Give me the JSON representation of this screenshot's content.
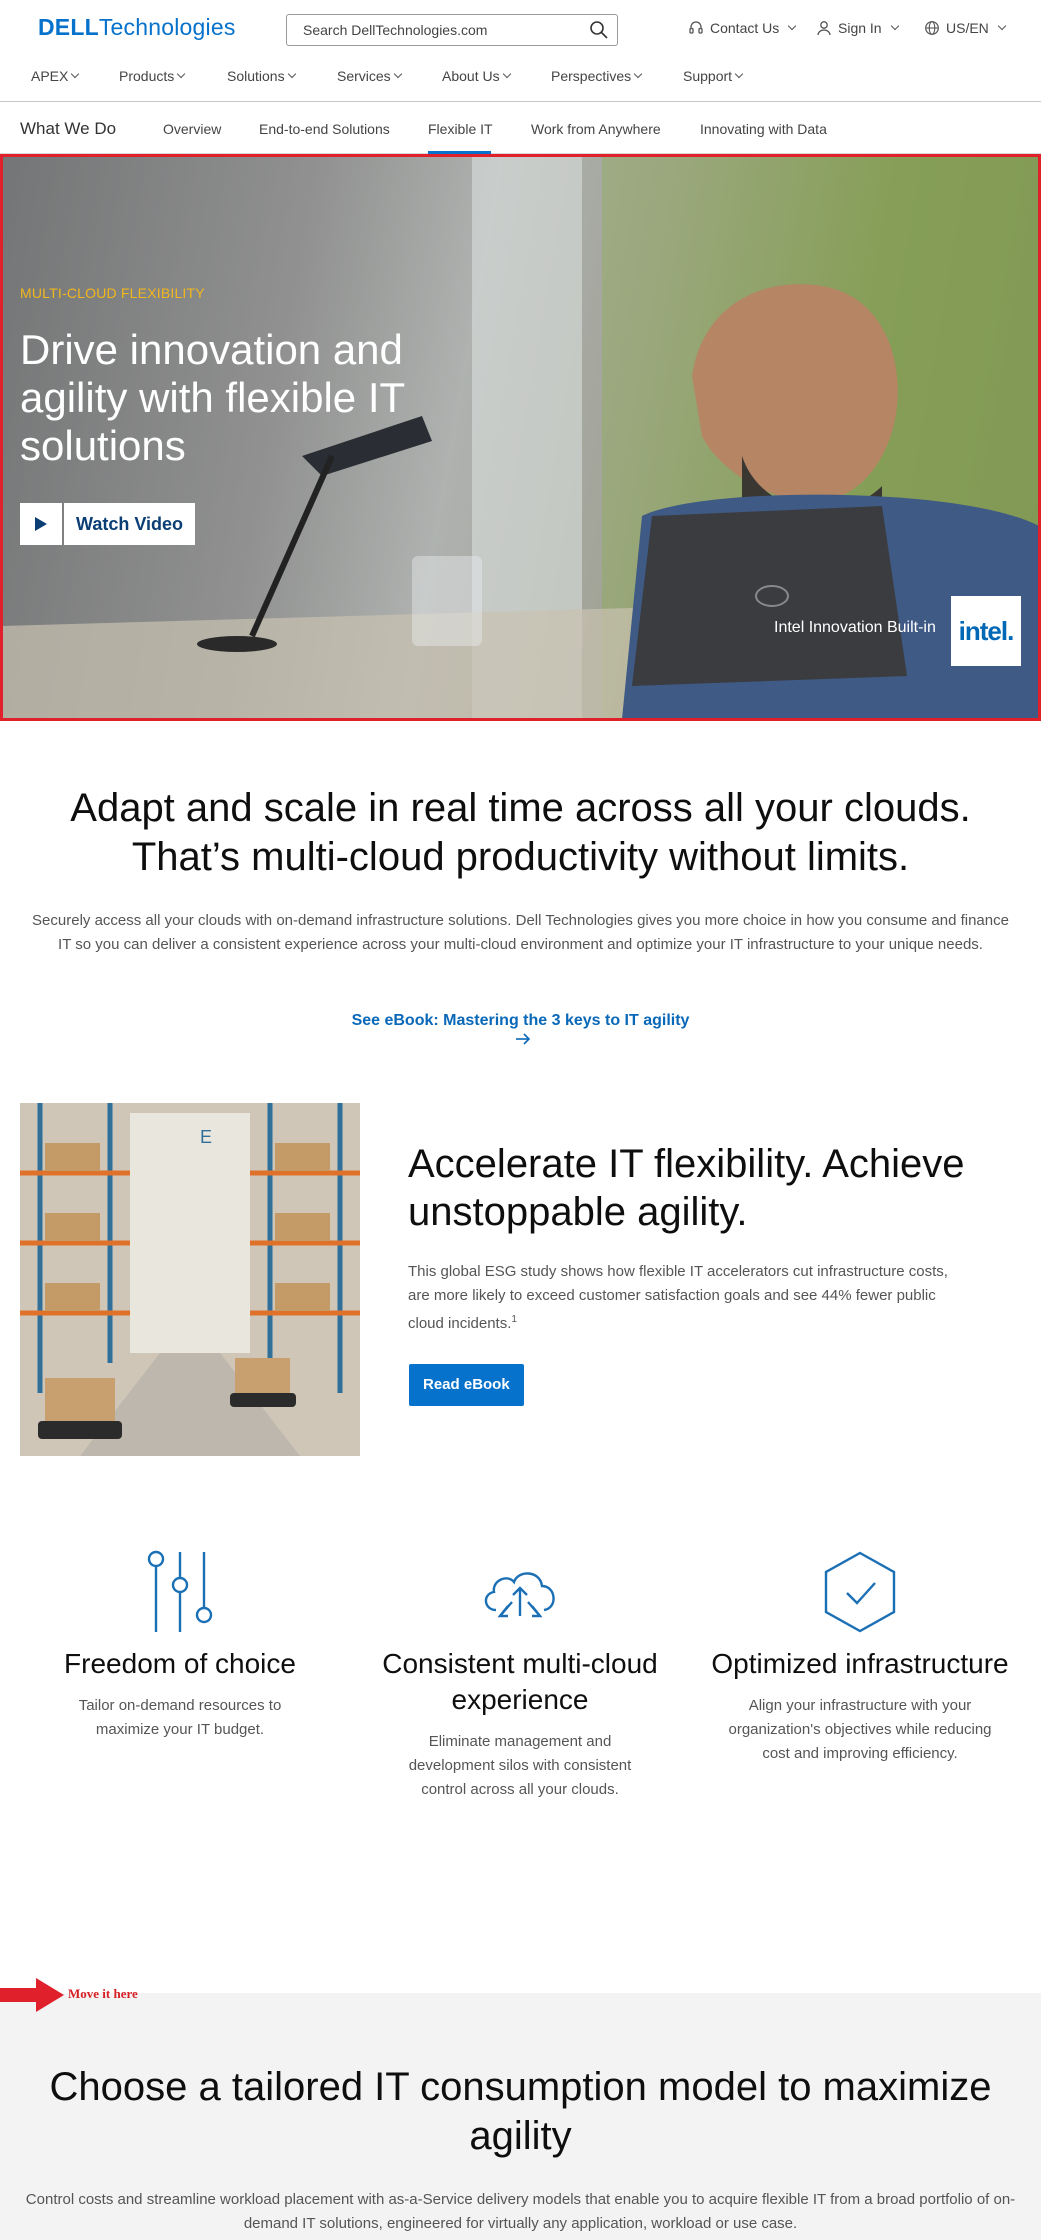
{
  "header": {
    "logo_bold": "DELL",
    "logo_rest": "Technologies",
    "search_placeholder": "Search DellTechnologies.com",
    "contact": "Contact Us",
    "sign_in": "Sign In",
    "locale": "US/EN"
  },
  "nav": {
    "items": [
      "APEX",
      "Products",
      "Solutions",
      "Services",
      "About Us",
      "Perspectives",
      "Support"
    ]
  },
  "subnav": {
    "title": "What We Do",
    "tabs": [
      "Overview",
      "End-to-end Solutions",
      "Flexible IT",
      "Work from Anywhere",
      "Innovating with Data"
    ],
    "active_tab": "Flexible IT"
  },
  "hero": {
    "kicker": "MULTI-CLOUD FLEXIBILITY",
    "headline": "Drive innovation and agility with flexible IT solutions",
    "watch_label": "Watch Video",
    "intel_text": "Intel Innovation Built-in",
    "intel_logo": "intel."
  },
  "intro": {
    "headline": "Adapt and scale in real time across all your clouds. That’s multi-cloud productivity without limits.",
    "body": "Securely access all your clouds with on-demand infrastructure solutions. Dell Technologies gives you more choice in how you consume and finance IT so you can deliver a consistent experience across your multi-cloud environment and optimize your IT infrastructure to your unique needs.",
    "link": "See eBook: Mastering the 3 keys to IT agility"
  },
  "feature": {
    "headline": "Accelerate IT flexibility. Achieve unstoppable agility.",
    "body": "This global ESG study shows how flexible IT accelerators cut infrastructure costs, are more likely to exceed customer satisfaction goals and see 44% fewer public cloud incidents.",
    "footnote": "1",
    "button": "Read eBook"
  },
  "pillars": [
    {
      "icon": "sliders-icon",
      "title": "Freedom of choice",
      "body": "Tailor on-demand resources to maximize your IT budget."
    },
    {
      "icon": "cloud-arrows-icon",
      "title": "Consistent multi-cloud experience",
      "body": "Eliminate management and development silos with consistent control across all your clouds."
    },
    {
      "icon": "hexagon-check-icon",
      "title": "Optimized infrastructure",
      "body": "Align your infrastructure with your organization's objectives while reducing cost and improving efficiency."
    }
  ],
  "annotation": {
    "text": "Move it here",
    "color": "#d81f26"
  },
  "consume": {
    "headline": "Choose a tailored IT consumption model to maximize agility",
    "body": "Control costs and streamline workload placement with as-a-Service delivery models that enable you to acquire flexible IT from a broad portfolio of on-demand IT solutions, engineered for virtually any application, workload or use case."
  },
  "colors": {
    "brand": "#0672cb",
    "kicker": "#f2b71d",
    "highlight_frame": "#e0202a"
  }
}
